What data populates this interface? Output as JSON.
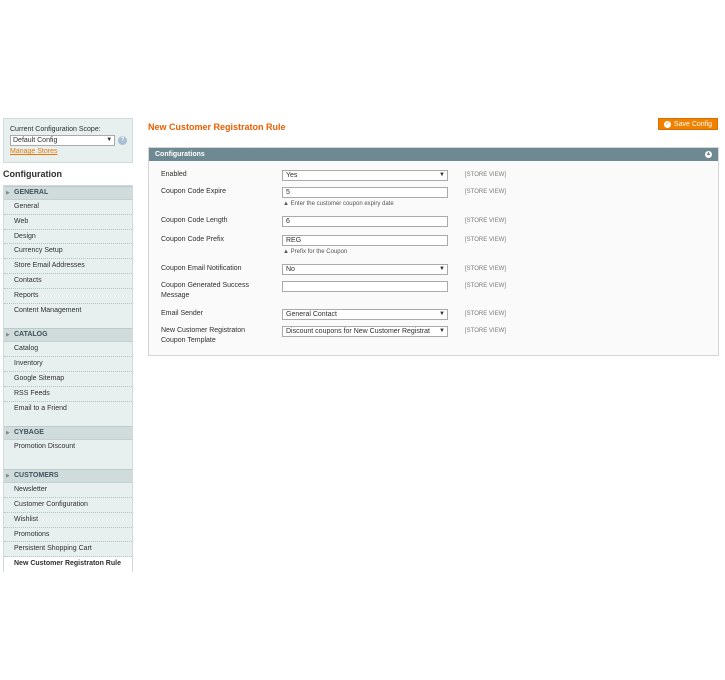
{
  "sidebar": {
    "scope_label": "Current Configuration Scope:",
    "scope_value": "Default Config",
    "manage_link": "Manage Stores",
    "title": "Configuration",
    "groups": [
      {
        "name": "GENERAL",
        "items": [
          "General",
          "Web",
          "Design",
          "Currency Setup",
          "Store Email Addresses",
          "Contacts",
          "Reports",
          "Content Management"
        ]
      },
      {
        "name": "CATALOG",
        "items": [
          "Catalog",
          "Inventory",
          "Google Sitemap",
          "RSS Feeds",
          "Email to a Friend"
        ]
      },
      {
        "name": "CYBAGE",
        "items": [
          "Promotion Discount"
        ]
      },
      {
        "name": "CUSTOMERS",
        "items": [
          "Newsletter",
          "Customer Configuration",
          "Wishlist",
          "Promotions",
          "Persistent Shopping Cart",
          "New Customer Registraton Rule"
        ]
      }
    ]
  },
  "main": {
    "page_title": "New Customer Registraton Rule",
    "save_label": "Save Config",
    "section_title": "Configurations",
    "fields": [
      {
        "label": "Enabled",
        "value": "Yes",
        "type": "select",
        "scope": "[STORE VIEW]"
      },
      {
        "label": "Coupon Code Expire",
        "value": "5",
        "type": "input",
        "scope": "[STORE VIEW]",
        "note": "Enter the customer coupon expiry date"
      },
      {
        "label": "Coupon Code Length",
        "value": "6",
        "type": "input",
        "scope": "[STORE VIEW]"
      },
      {
        "label": "Coupon Code Prefix",
        "value": "REG",
        "type": "input",
        "scope": "[STORE VIEW]",
        "note": "Prefix for the Coupon"
      },
      {
        "label": "Coupon Email Notification",
        "value": "No",
        "type": "select",
        "scope": "[STORE VIEW]"
      },
      {
        "label": "Coupon Generated Success Message",
        "value": "",
        "type": "input",
        "scope": "[STORE VIEW]"
      },
      {
        "label": "Email Sender",
        "value": "General Contact",
        "type": "select",
        "scope": "[STORE VIEW]"
      },
      {
        "label": "New Customer Registraton Coupon Template",
        "value": "Discount coupons for New Customer Registrat",
        "type": "select",
        "scope": "[STORE VIEW]"
      }
    ]
  }
}
